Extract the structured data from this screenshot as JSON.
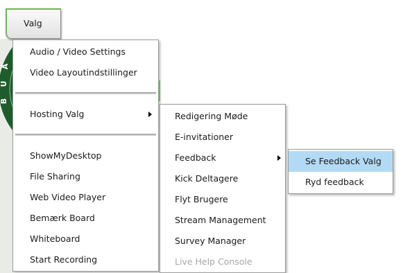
{
  "menu_button": {
    "label": "Valg"
  },
  "logo": {
    "letters": [
      "A",
      "U",
      "B"
    ]
  },
  "colors": {
    "accent_green": "#74b05a",
    "logo_green": "#1f5c2c",
    "highlight": "#b3daf5",
    "disabled_text": "#a7a7a7",
    "menu_border": "#9a9a9a"
  },
  "main_menu": {
    "items": [
      {
        "label": "Audio / Video Settings"
      },
      {
        "label": "Video Layoutindstillinger"
      },
      {
        "label": "Hosting Valg",
        "has_submenu": true,
        "submenu_icon": "triangle-right-icon"
      },
      {
        "label": "ShowMyDesktop"
      },
      {
        "label": "File Sharing"
      },
      {
        "label": "Web Video Player"
      },
      {
        "label": "Bemærk Board"
      },
      {
        "label": "Whiteboard"
      },
      {
        "label": "Start Recording"
      }
    ]
  },
  "hosting_submenu": {
    "items": [
      {
        "label": "Redigering Møde"
      },
      {
        "label": "E-invitationer"
      },
      {
        "label": "Feedback",
        "has_submenu": true,
        "submenu_icon": "triangle-right-icon"
      },
      {
        "label": "Kick Deltagere"
      },
      {
        "label": "Flyt Brugere"
      },
      {
        "label": "Stream Management"
      },
      {
        "label": "Survey Manager"
      },
      {
        "label": "Live Help Console",
        "disabled": true
      }
    ]
  },
  "feedback_submenu": {
    "items": [
      {
        "label": "Se Feedback Valg",
        "highlighted": true
      },
      {
        "label": "Ryd feedback"
      }
    ]
  }
}
